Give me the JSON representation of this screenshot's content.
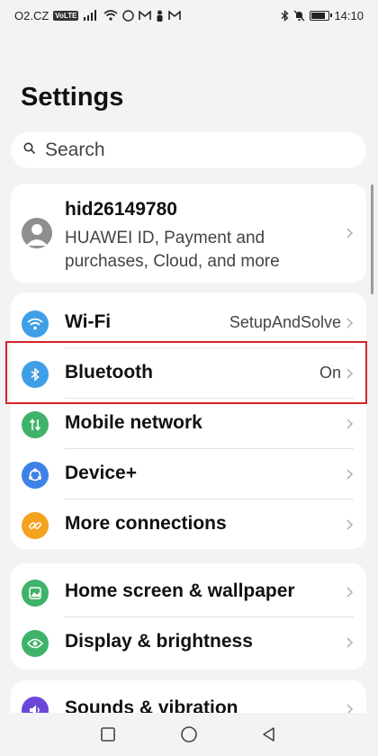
{
  "status_bar": {
    "carrier": "O2.CZ",
    "volte": "VoLTE",
    "signal": "4G",
    "time": "14:10",
    "battery_level": 0.9
  },
  "page": {
    "title": "Settings"
  },
  "search": {
    "placeholder": "Search"
  },
  "account": {
    "name": "hid26149780",
    "description": "HUAWEI ID, Payment and purchases, Cloud, and more"
  },
  "connections": [
    {
      "label": "Wi-Fi",
      "value": "SetupAndSolve",
      "icon": "wifi-icon",
      "color": "#3f9fe6"
    },
    {
      "label": "Bluetooth",
      "value": "On",
      "icon": "bluetooth-icon",
      "color": "#3f9fe6"
    },
    {
      "label": "Mobile network",
      "value": "",
      "icon": "mobile-data-icon",
      "color": "#3fb36a"
    },
    {
      "label": "Device+",
      "value": "",
      "icon": "device-plus-icon",
      "color": "#3f82e6"
    },
    {
      "label": "More connections",
      "value": "",
      "icon": "link-icon",
      "color": "#f5a21f"
    }
  ],
  "display": [
    {
      "label": "Home screen & wallpaper",
      "icon": "wallpaper-icon",
      "color": "#3fb36a"
    },
    {
      "label": "Display & brightness",
      "icon": "eye-icon",
      "color": "#3fb36a"
    }
  ],
  "sound": [
    {
      "label": "Sounds & vibration",
      "icon": "speaker-icon",
      "color": "#6b47d9"
    }
  ]
}
